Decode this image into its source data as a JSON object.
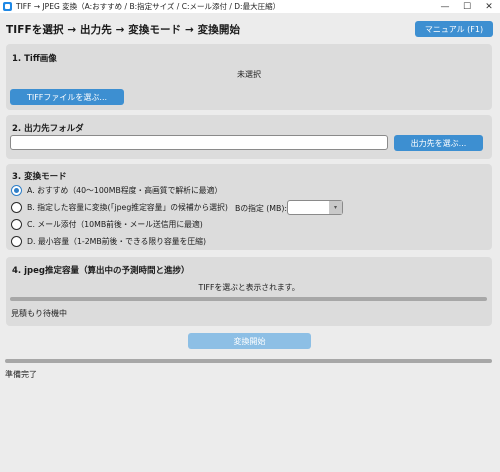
{
  "window": {
    "title": "TIFF → JPEG 変換（A:おすすめ / B:指定サイズ / C:メール添付 / D:最大圧縮）",
    "controls": {
      "minimize": "—",
      "maximize": "☐",
      "close": "✕"
    }
  },
  "header": {
    "steps": "TIFFを選択 → 出力先 → 変換モード → 変換開始",
    "manual_label": "マニュアル (F1)"
  },
  "tiff_section": {
    "title": "1. Tiff画像",
    "status": "未選択",
    "select_button": "TIFFファイルを選ぶ..."
  },
  "output_section": {
    "title": "2. 出力先フォルダ",
    "path_value": "",
    "select_button": "出力先を選ぶ..."
  },
  "mode_section": {
    "title": "3. 変換モード",
    "options": [
      {
        "label": "A. おすすめ（40〜100MB程度・高画質で解析に最適）",
        "checked": true
      },
      {
        "label": "B. 指定した容量に変換(「jpeg推定容量」の候補から選択)",
        "checked": false
      },
      {
        "label": "C. メール添付（10MB前後・メール送信用に最適)",
        "checked": false
      },
      {
        "label": "D. 最小容量（1-2MB前後・できる限り容量を圧縮)",
        "checked": false
      }
    ],
    "mb_label": "Bの指定 (MB):",
    "mb_value": "",
    "mb_arrow": "▾"
  },
  "estimate_section": {
    "title": "4. jpeg推定容量（算出中の予測時間と進捗）",
    "status": "TIFFを選ぶと表示されます。",
    "progress": 0,
    "label": "見積もり待機中"
  },
  "start_button": "変換開始",
  "main_progress": 0,
  "status_bar": "準備完了",
  "colors": {
    "accent": "#3d8fd1",
    "disabled": "#8dbfe5",
    "track": "#a7a7a7"
  }
}
